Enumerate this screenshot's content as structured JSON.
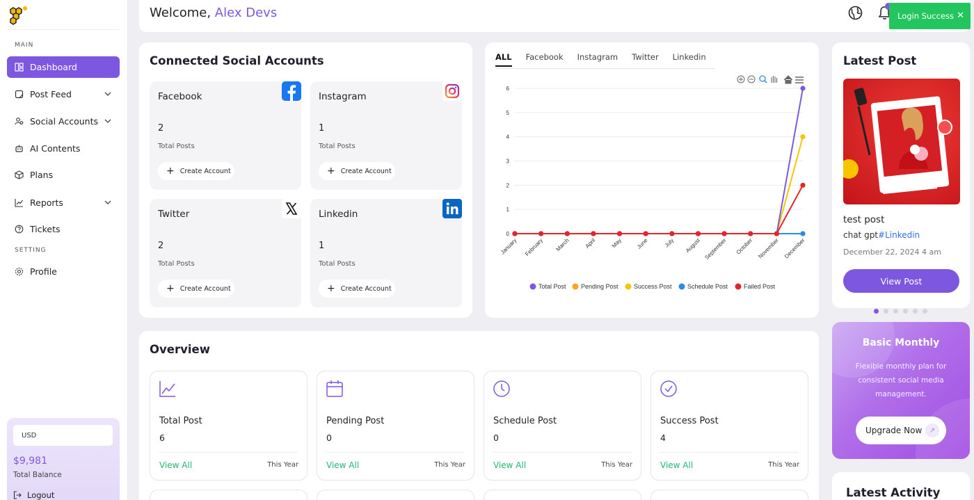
{
  "sidebar": {
    "section_main": "MAIN",
    "section_setting": "SETTING",
    "items": [
      {
        "label": "Dashboard"
      },
      {
        "label": "Post Feed"
      },
      {
        "label": "Social Accounts"
      },
      {
        "label": "AI Contents"
      },
      {
        "label": "Plans"
      },
      {
        "label": "Reports"
      },
      {
        "label": "Tickets"
      },
      {
        "label": "Profile"
      }
    ],
    "currency": "USD",
    "balance_amount": "$9,981",
    "balance_label": "Total Balance",
    "logout": "Logout"
  },
  "header": {
    "welcome": "Welcome,",
    "user_name": "Alex Devs"
  },
  "toast": {
    "message": "Login Success",
    "close": "✕"
  },
  "social": {
    "title": "Connected Social Accounts",
    "accounts": [
      {
        "name": "Facebook",
        "count": "2",
        "label": "Total Posts",
        "button": "Create Account",
        "icon": "facebook-icon"
      },
      {
        "name": "Instagram",
        "count": "1",
        "label": "Total Posts",
        "button": "Create Account",
        "icon": "instagram-icon"
      },
      {
        "name": "Twitter",
        "count": "2",
        "label": "Total Posts",
        "button": "Create Account",
        "icon": "x-icon"
      },
      {
        "name": "Linkedin",
        "count": "1",
        "label": "Total Posts",
        "button": "Create Account",
        "icon": "linkedin-icon"
      }
    ]
  },
  "chart_tabs": [
    "ALL",
    "Facebook",
    "Instagram",
    "Twitter",
    "Linkedin"
  ],
  "chart_data": {
    "type": "line",
    "categories": [
      "January",
      "February",
      "March",
      "April",
      "May",
      "June",
      "July",
      "August",
      "September",
      "October",
      "November",
      "December"
    ],
    "ylim": [
      0,
      6
    ],
    "yticks": [
      "0",
      "1",
      "2",
      "3",
      "4",
      "5",
      "6"
    ],
    "grid": true,
    "legend_position": "bottom",
    "series": [
      {
        "name": "Total Post",
        "color": "#7e57e0",
        "values": [
          0,
          0,
          0,
          0,
          0,
          0,
          0,
          0,
          0,
          0,
          0,
          6
        ]
      },
      {
        "name": "Pending Post",
        "color": "#f5a623",
        "values": [
          0,
          0,
          0,
          0,
          0,
          0,
          0,
          0,
          0,
          0,
          0,
          0
        ]
      },
      {
        "name": "Success Post",
        "color": "#f7c600",
        "values": [
          0,
          0,
          0,
          0,
          0,
          0,
          0,
          0,
          0,
          0,
          0,
          4
        ]
      },
      {
        "name": "Schedule Post",
        "color": "#2f8ae6",
        "values": [
          0,
          0,
          0,
          0,
          0,
          0,
          0,
          0,
          0,
          0,
          0,
          0
        ]
      },
      {
        "name": "Failed Post",
        "color": "#e5252a",
        "values": [
          0,
          0,
          0,
          0,
          0,
          0,
          0,
          0,
          0,
          0,
          0,
          2
        ]
      }
    ]
  },
  "latest_post": {
    "title": "Latest Post",
    "post_title": "test post",
    "caption_prefix": "chat gpt",
    "caption_tag": "#Linkedin",
    "date": "December 22, 2024 4 am",
    "button": "View Post"
  },
  "plan": {
    "title": "Basic Monthly",
    "description": "Flexible monthly plan for consistent social media management.",
    "button": "Upgrade Now",
    "arrow": "↗"
  },
  "overview": {
    "title": "Overview",
    "cards": [
      {
        "name": "Total Post",
        "value": "6",
        "link": "View All",
        "period": "This Year"
      },
      {
        "name": "Pending Post",
        "value": "0",
        "link": "View All",
        "period": "This Year"
      },
      {
        "name": "Schedule Post",
        "value": "0",
        "link": "View All",
        "period": "This Year"
      },
      {
        "name": "Success Post",
        "value": "4",
        "link": "View All",
        "period": "This Year"
      }
    ]
  },
  "latest_activity": {
    "title": "Latest Activity"
  },
  "colors": {
    "accent": "#7e57e0",
    "success": "#22c55e",
    "link_green": "#22b573"
  }
}
